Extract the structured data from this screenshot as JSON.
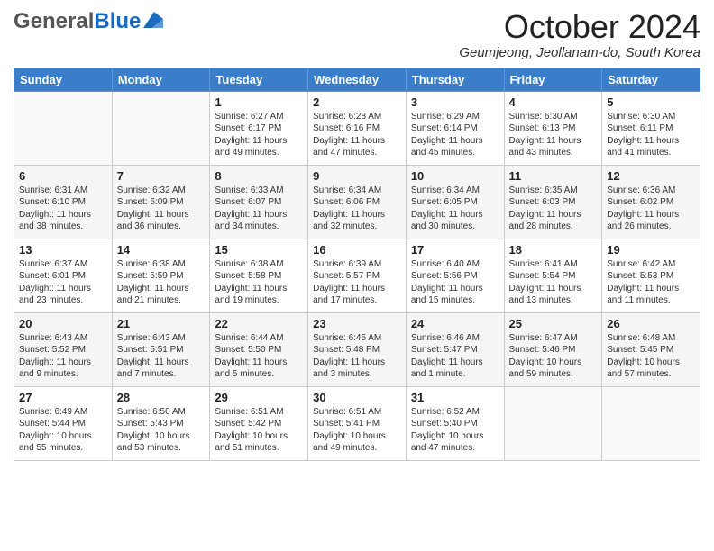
{
  "header": {
    "logo_general": "General",
    "logo_blue": "Blue",
    "month_title": "October 2024",
    "location": "Geumjeong, Jeollanam-do, South Korea"
  },
  "days_of_week": [
    "Sunday",
    "Monday",
    "Tuesday",
    "Wednesday",
    "Thursday",
    "Friday",
    "Saturday"
  ],
  "weeks": [
    [
      {
        "day": "",
        "content": ""
      },
      {
        "day": "",
        "content": ""
      },
      {
        "day": "1",
        "content": "Sunrise: 6:27 AM\nSunset: 6:17 PM\nDaylight: 11 hours and 49 minutes."
      },
      {
        "day": "2",
        "content": "Sunrise: 6:28 AM\nSunset: 6:16 PM\nDaylight: 11 hours and 47 minutes."
      },
      {
        "day": "3",
        "content": "Sunrise: 6:29 AM\nSunset: 6:14 PM\nDaylight: 11 hours and 45 minutes."
      },
      {
        "day": "4",
        "content": "Sunrise: 6:30 AM\nSunset: 6:13 PM\nDaylight: 11 hours and 43 minutes."
      },
      {
        "day": "5",
        "content": "Sunrise: 6:30 AM\nSunset: 6:11 PM\nDaylight: 11 hours and 41 minutes."
      }
    ],
    [
      {
        "day": "6",
        "content": "Sunrise: 6:31 AM\nSunset: 6:10 PM\nDaylight: 11 hours and 38 minutes."
      },
      {
        "day": "7",
        "content": "Sunrise: 6:32 AM\nSunset: 6:09 PM\nDaylight: 11 hours and 36 minutes."
      },
      {
        "day": "8",
        "content": "Sunrise: 6:33 AM\nSunset: 6:07 PM\nDaylight: 11 hours and 34 minutes."
      },
      {
        "day": "9",
        "content": "Sunrise: 6:34 AM\nSunset: 6:06 PM\nDaylight: 11 hours and 32 minutes."
      },
      {
        "day": "10",
        "content": "Sunrise: 6:34 AM\nSunset: 6:05 PM\nDaylight: 11 hours and 30 minutes."
      },
      {
        "day": "11",
        "content": "Sunrise: 6:35 AM\nSunset: 6:03 PM\nDaylight: 11 hours and 28 minutes."
      },
      {
        "day": "12",
        "content": "Sunrise: 6:36 AM\nSunset: 6:02 PM\nDaylight: 11 hours and 26 minutes."
      }
    ],
    [
      {
        "day": "13",
        "content": "Sunrise: 6:37 AM\nSunset: 6:01 PM\nDaylight: 11 hours and 23 minutes."
      },
      {
        "day": "14",
        "content": "Sunrise: 6:38 AM\nSunset: 5:59 PM\nDaylight: 11 hours and 21 minutes."
      },
      {
        "day": "15",
        "content": "Sunrise: 6:38 AM\nSunset: 5:58 PM\nDaylight: 11 hours and 19 minutes."
      },
      {
        "day": "16",
        "content": "Sunrise: 6:39 AM\nSunset: 5:57 PM\nDaylight: 11 hours and 17 minutes."
      },
      {
        "day": "17",
        "content": "Sunrise: 6:40 AM\nSunset: 5:56 PM\nDaylight: 11 hours and 15 minutes."
      },
      {
        "day": "18",
        "content": "Sunrise: 6:41 AM\nSunset: 5:54 PM\nDaylight: 11 hours and 13 minutes."
      },
      {
        "day": "19",
        "content": "Sunrise: 6:42 AM\nSunset: 5:53 PM\nDaylight: 11 hours and 11 minutes."
      }
    ],
    [
      {
        "day": "20",
        "content": "Sunrise: 6:43 AM\nSunset: 5:52 PM\nDaylight: 11 hours and 9 minutes."
      },
      {
        "day": "21",
        "content": "Sunrise: 6:43 AM\nSunset: 5:51 PM\nDaylight: 11 hours and 7 minutes."
      },
      {
        "day": "22",
        "content": "Sunrise: 6:44 AM\nSunset: 5:50 PM\nDaylight: 11 hours and 5 minutes."
      },
      {
        "day": "23",
        "content": "Sunrise: 6:45 AM\nSunset: 5:48 PM\nDaylight: 11 hours and 3 minutes."
      },
      {
        "day": "24",
        "content": "Sunrise: 6:46 AM\nSunset: 5:47 PM\nDaylight: 11 hours and 1 minute."
      },
      {
        "day": "25",
        "content": "Sunrise: 6:47 AM\nSunset: 5:46 PM\nDaylight: 10 hours and 59 minutes."
      },
      {
        "day": "26",
        "content": "Sunrise: 6:48 AM\nSunset: 5:45 PM\nDaylight: 10 hours and 57 minutes."
      }
    ],
    [
      {
        "day": "27",
        "content": "Sunrise: 6:49 AM\nSunset: 5:44 PM\nDaylight: 10 hours and 55 minutes."
      },
      {
        "day": "28",
        "content": "Sunrise: 6:50 AM\nSunset: 5:43 PM\nDaylight: 10 hours and 53 minutes."
      },
      {
        "day": "29",
        "content": "Sunrise: 6:51 AM\nSunset: 5:42 PM\nDaylight: 10 hours and 51 minutes."
      },
      {
        "day": "30",
        "content": "Sunrise: 6:51 AM\nSunset: 5:41 PM\nDaylight: 10 hours and 49 minutes."
      },
      {
        "day": "31",
        "content": "Sunrise: 6:52 AM\nSunset: 5:40 PM\nDaylight: 10 hours and 47 minutes."
      },
      {
        "day": "",
        "content": ""
      },
      {
        "day": "",
        "content": ""
      }
    ]
  ]
}
